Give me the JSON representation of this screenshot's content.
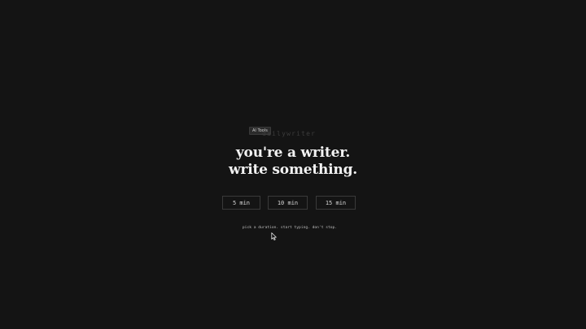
{
  "badge": {
    "label": "AI Tools"
  },
  "brand": {
    "name": "dailywriter"
  },
  "headline": {
    "line1": "you're a writer.",
    "line2": "write something."
  },
  "durations": [
    {
      "label": "5 min"
    },
    {
      "label": "10 min"
    },
    {
      "label": "15 min"
    }
  ],
  "hint": {
    "text": "pick a duration. start typing. don't stop."
  },
  "cursor": {
    "icon": "mouse-pointer-icon"
  },
  "colors": {
    "background": "#141414",
    "text": "#f2f2f2",
    "brand": "#3c3c3c",
    "button_border": "#3a3a3a"
  }
}
